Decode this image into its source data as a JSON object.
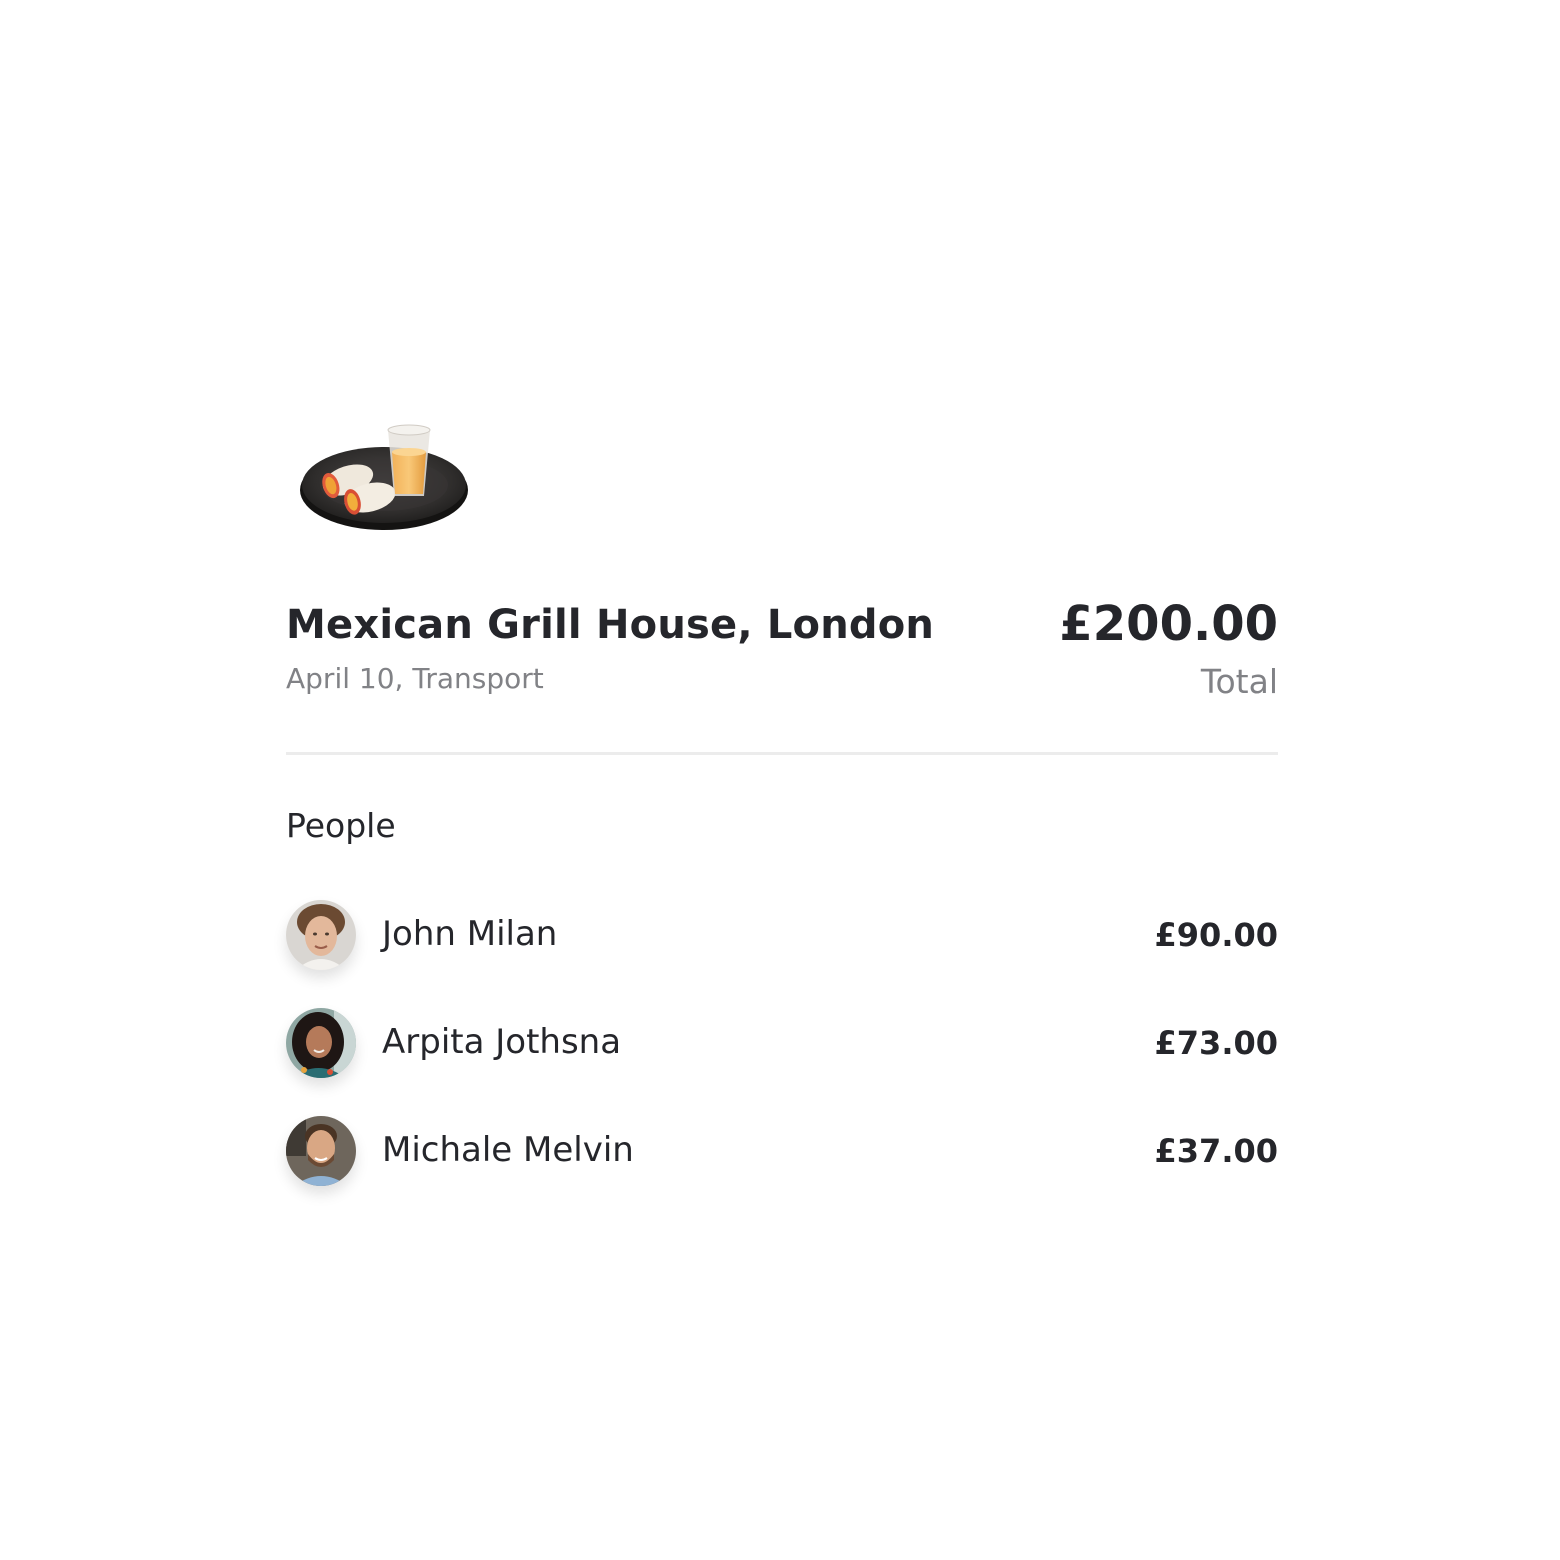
{
  "expense": {
    "title": "Mexican Grill House, London",
    "subtitle": "April 10, Transport",
    "total_amount": "£200.00",
    "total_label": "Total",
    "icon": "food-plate-icon"
  },
  "people_section": {
    "title": "People",
    "items": [
      {
        "name": "John Milan",
        "amount": "£90.00"
      },
      {
        "name": "Arpita Jothsna",
        "amount": "£73.00"
      },
      {
        "name": "Michale Melvin",
        "amount": "£37.00"
      }
    ]
  },
  "colors": {
    "text_primary": "#25262b",
    "text_secondary": "#818286",
    "divider": "#ececec",
    "background": "#ffffff"
  }
}
